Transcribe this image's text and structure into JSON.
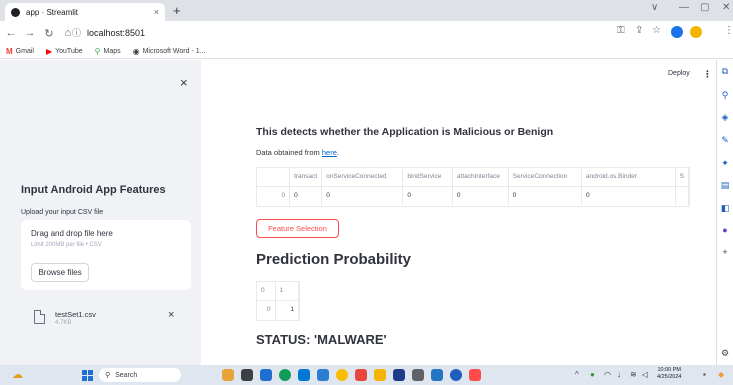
{
  "browser": {
    "tab_title": "app · Streamlit",
    "tab_close": "×",
    "new_tab": "+",
    "url": "localhost:8501",
    "win_min": "∨",
    "win_restore": "—",
    "win_max": "▢",
    "win_close": "✕",
    "bookmarks": [
      {
        "label": "Gmail",
        "icon": "M",
        "color": "#ea4335"
      },
      {
        "label": "YouTube",
        "icon": "▶",
        "color": "#ff0000"
      },
      {
        "label": "Maps",
        "icon": "⚲",
        "color": "#34a853"
      },
      {
        "label": "Microsoft Word - 1...",
        "icon": "◉",
        "color": "#3c4043"
      }
    ]
  },
  "sidebar": {
    "close": "×",
    "title": "Input Android App Features",
    "upload_label": "Upload your input CSV file",
    "drop_title": "Drag and drop file here",
    "drop_limit": "Limit 200MB per file • CSV",
    "browse_label": "Browse files",
    "file_name": "testSet1.csv",
    "file_size": "4.7KB",
    "file_remove": "×"
  },
  "header": {
    "deploy": "Deploy",
    "menu": "⋮"
  },
  "main": {
    "title": "This detects whether the Application is Malicious or Benign",
    "data_src_prefix": "Data obtained from ",
    "data_src_link": "here",
    "data_src_suffix": ".",
    "feature_button": "Feature Selection",
    "pp_title": "Prediction Probability",
    "status": "STATUS: 'MALWARE'"
  },
  "features_table": {
    "columns": [
      "",
      "transact",
      "onServiceConnected",
      "bindService",
      "attachInterface",
      "ServiceConnection",
      "android.os.Binder",
      "S"
    ],
    "rows": [
      [
        "0",
        "0",
        "0",
        "0",
        "0",
        "0",
        "0",
        ""
      ]
    ]
  },
  "prob_table": {
    "columns": [
      "0",
      "1"
    ],
    "rows": [
      [
        "0",
        "1"
      ]
    ]
  },
  "taskbar": {
    "search": "Search",
    "time": "10:00 PM",
    "date": "4/25/2024"
  }
}
